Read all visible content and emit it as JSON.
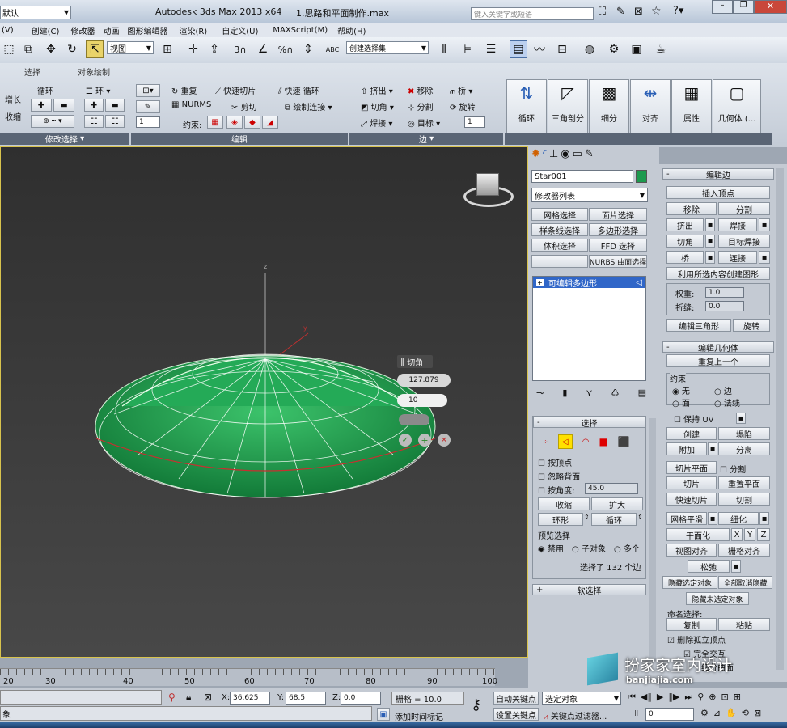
{
  "title_bar": {
    "workspace": "默认",
    "app_title": "Autodesk 3ds Max  2013 x64",
    "file_name": "1.思路和平面制作.max",
    "search_placeholder": "键入关键字或短语"
  },
  "menu": [
    "(V)",
    "创建(C)",
    "修改器",
    "动画",
    "图形编辑器",
    "渲染(R)",
    "自定义(U)",
    "MAXScript(M)",
    "帮助(H)"
  ],
  "main_toolbar": {
    "view_dropdown": "视图",
    "selection_set": "创建选择集",
    "snap_labels": [
      "3",
      "%",
      "ABC"
    ]
  },
  "ribbon": {
    "tabs": [
      "选择",
      "对象绘制"
    ],
    "col1": {
      "grow": "增长",
      "shrink": "收缩",
      "loop": "循环",
      "ring": "环"
    },
    "col2_spinner": "1",
    "edit": {
      "repeat": "重复",
      "quickslice": "快速切片",
      "quickloop": "快速 循环",
      "nurms": "NURMS",
      "cut": "剪切",
      "paint_connect": "绘制连接",
      "constraints": "约束:"
    },
    "edges": {
      "extrude": "挤出",
      "remove": "移除",
      "bridge": "桥",
      "chamfer": "切角",
      "split": "分割",
      "spin": "旋转",
      "weld": "焊接",
      "target": "目标",
      "spinner": "1"
    },
    "big": [
      "循环",
      "三角剖分",
      "细分",
      "对齐",
      "属性",
      "几何体 (..."
    ],
    "footers": {
      "modify_select": "修改选择",
      "edit": "编辑",
      "edge": "边"
    }
  },
  "viewport": {
    "caddy_title": "切角",
    "caddy_value1": "127.879",
    "caddy_value2": "10",
    "axis_z": "z",
    "axis_y": "y"
  },
  "command_panel": {
    "object_name": "Star001",
    "modifier_list": "修改器列表",
    "mod_buttons": [
      "网格选择",
      "面片选择",
      "样条线选择",
      "多边形选择",
      "体积选择",
      "FFD 选择",
      "",
      "NURBS 曲面选择"
    ],
    "stack_item": "可编辑多边形",
    "selection": {
      "title": "选择",
      "by_vertex": "按顶点",
      "ignore_back": "忽略背面",
      "by_angle": "按角度:",
      "angle_val": "45.0",
      "shrink": "收缩",
      "grow": "扩大",
      "ring": "环形",
      "loop": "循环",
      "preview": "预览选择",
      "disabled": "禁用",
      "subobj": "子对象",
      "multi": "多个",
      "status": "选择了 132 个边"
    },
    "soft_select": "软选择"
  },
  "edit_edges": {
    "title": "编辑边",
    "insert_vertex": "插入顶点",
    "remove": "移除",
    "split": "分割",
    "extrude": "挤出",
    "weld": "焊接",
    "chamfer": "切角",
    "target_weld": "目标焊接",
    "bridge": "桥",
    "connect": "连接",
    "create_shape": "利用所选内容创建图形",
    "weight": "权重:",
    "weight_val": "1.0",
    "crease": "折缝:",
    "crease_val": "0.0",
    "edit_tri": "编辑三角形",
    "turn": "旋转"
  },
  "edit_geometry": {
    "title": "编辑几何体",
    "repeat_last": "重复上一个",
    "constraints": "约束",
    "none": "无",
    "edge": "边",
    "face": "面",
    "normal": "法线",
    "preserve_uv": "保持 UV",
    "create": "创建",
    "collapse": "塌陷",
    "attach": "附加",
    "detach": "分离",
    "slice_plane": "切片平面",
    "split": "分割",
    "slice": "切片",
    "reset_plane": "重置平面",
    "quickslice": "快速切片",
    "cut": "切割",
    "meshsmooth": "网格平滑",
    "tessellate": "细化",
    "make_planar": "平面化",
    "x": "X",
    "y": "Y",
    "z": "Z",
    "view_align": "视图对齐",
    "grid_align": "栅格对齐",
    "relax": "松弛",
    "hide_sel": "隐藏选定对象",
    "unhide_all": "全部取消隐藏",
    "hide_unsel": "隐藏未选定对象",
    "named_sel": "命名选择:",
    "copy": "复制",
    "paste": "粘贴",
    "delete_iso": "删除孤立顶点",
    "full_interact": "完全交互",
    "subdiv": "细分曲面"
  },
  "timeline": {
    "ticks": [
      "20",
      "30",
      "40",
      "50",
      "60",
      "70",
      "80",
      "90",
      "100"
    ]
  },
  "status_bar": {
    "x_label": "X:",
    "x_val": "36.625",
    "y_label": "Y:",
    "y_val": "68.5",
    "z_label": "Z:",
    "z_val": "0.0",
    "grid": "栅格 = 10.0",
    "auto_key": "自动关键点",
    "selected": "选定对象",
    "set_key": "设置关键点",
    "key_filters": "关键点过滤器...",
    "add_tag": "添加时间标记",
    "frame": "0",
    "left_text": "象"
  },
  "watermark": {
    "text": "扮家家室内设计",
    "url": "banjiajia.com"
  },
  "colors": {
    "viewport_bg": "#3f3f3f",
    "mesh": "#1d9a4e",
    "accent": "#3366cc",
    "highlight": "#ffe000"
  }
}
